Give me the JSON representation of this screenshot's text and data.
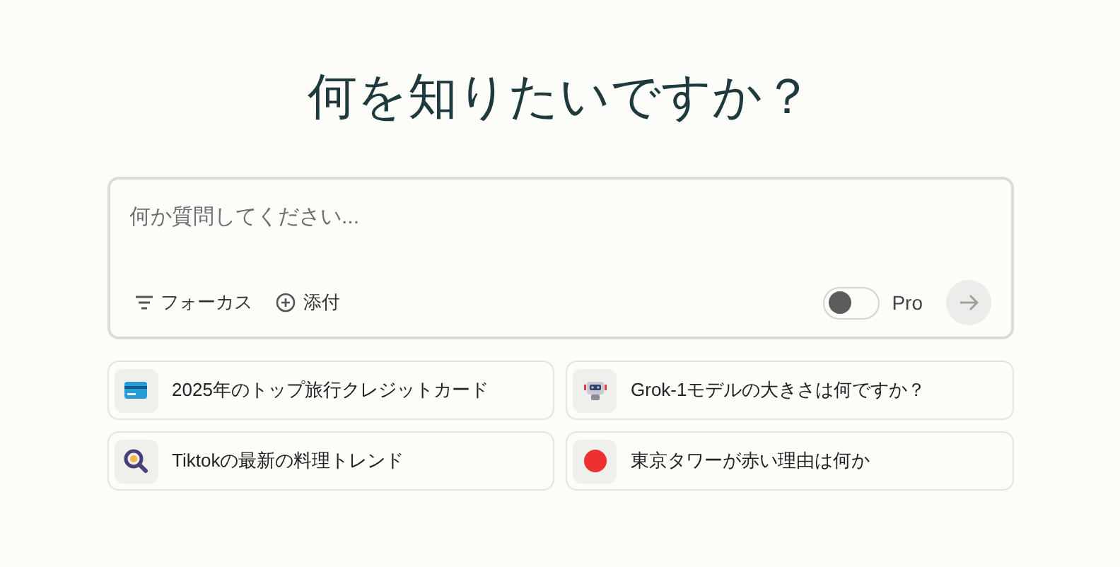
{
  "heading": "何を知りたいですか？",
  "query": {
    "placeholder": "何か質問してください..."
  },
  "toolbar": {
    "focus": "フォーカス",
    "attach": "添付",
    "pro": {
      "label": "Pro",
      "on": false
    }
  },
  "suggestions": [
    {
      "kind": "card",
      "text": "2025年のトップ旅行クレジットカード"
    },
    {
      "kind": "robot",
      "text": "Grok-1モデルの大きさは何ですか？"
    },
    {
      "kind": "magnifier",
      "text": "Tiktokの最新の料理トレンド"
    },
    {
      "kind": "dot",
      "text": "東京タワーが赤い理由は何か"
    }
  ]
}
